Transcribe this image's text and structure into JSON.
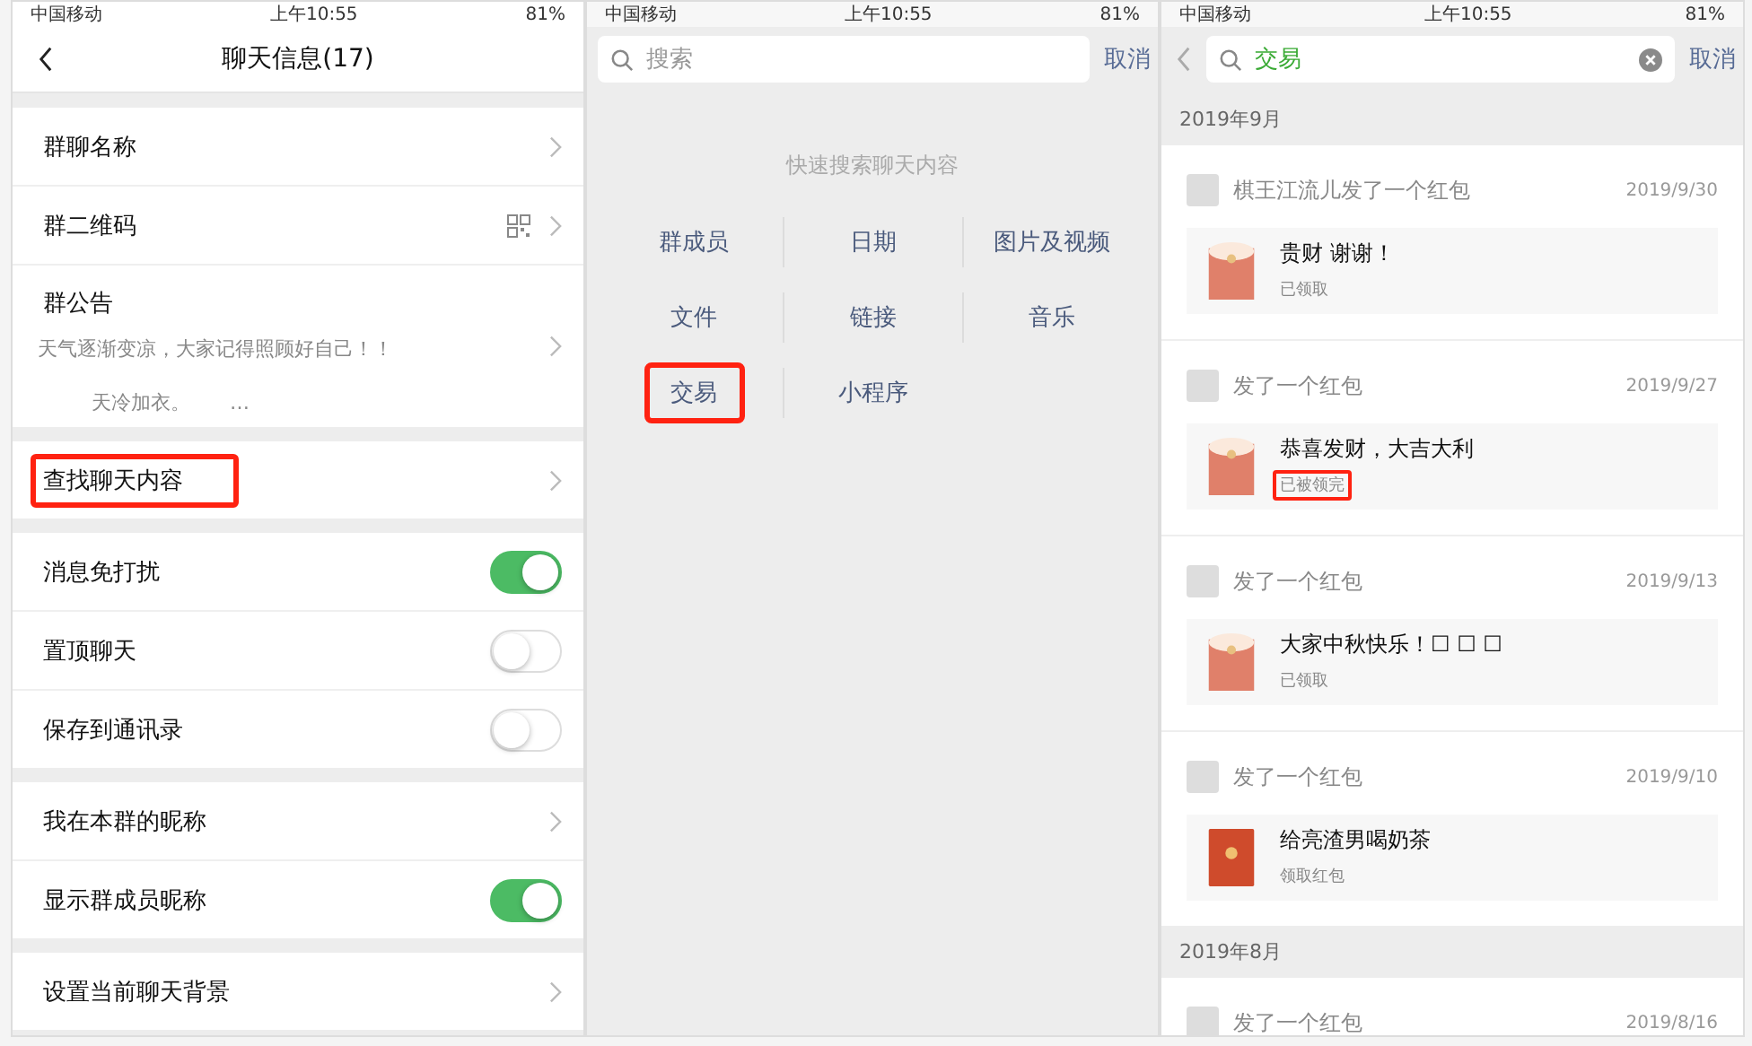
{
  "panels_status": [
    {
      "carrier": "中国移动",
      "time": "上午10:55",
      "battery": "81%"
    },
    {
      "carrier": "中国移动",
      "time": "上午10:55",
      "battery": "81%"
    },
    {
      "carrier": "中国移动",
      "time": "上午10:55",
      "battery": "81%"
    }
  ],
  "chat_info": {
    "title": "聊天信息(17)",
    "groups": [
      {
        "rows": [
          {
            "kind": "link",
            "label": "群聊名称",
            "highlighted": false
          },
          {
            "kind": "qr",
            "label": "群二维码",
            "highlighted": false
          },
          {
            "kind": "notice",
            "label": "群公告",
            "lines": [
              "天气逐渐变凉，大家记得照顾好自己！！",
              "天冷加衣。　　…"
            ],
            "highlighted": false
          }
        ]
      },
      {
        "rows": [
          {
            "kind": "link",
            "label": "查找聊天内容",
            "highlighted": true
          }
        ]
      },
      {
        "rows": [
          {
            "kind": "toggle",
            "label": "消息免打扰",
            "on": true,
            "highlighted": false
          },
          {
            "kind": "toggle",
            "label": "置顶聊天",
            "on": false,
            "highlighted": false
          },
          {
            "kind": "toggle",
            "label": "保存到通讯录",
            "on": false,
            "highlighted": false
          }
        ]
      },
      {
        "rows": [
          {
            "kind": "link",
            "label": "我在本群的昵称",
            "highlighted": false
          },
          {
            "kind": "toggle",
            "label": "显示群成员昵称",
            "on": true,
            "highlighted": false
          }
        ]
      },
      {
        "rows": [
          {
            "kind": "link",
            "label": "设置当前聊天背景",
            "highlighted": false
          }
        ]
      }
    ]
  },
  "quick_search": {
    "placeholder": "搜索",
    "cancel": "取消",
    "hint": "快速搜索聊天内容",
    "rows": [
      [
        {
          "label": "群成员",
          "highlighted": false
        },
        {
          "label": "日期",
          "highlighted": false
        },
        {
          "label": "图片及视频",
          "highlighted": false
        }
      ],
      [
        {
          "label": "文件",
          "highlighted": false
        },
        {
          "label": "链接",
          "highlighted": false
        },
        {
          "label": "音乐",
          "highlighted": false
        }
      ],
      [
        {
          "label": "交易",
          "highlighted": true
        },
        {
          "label": "小程序",
          "highlighted": false
        }
      ]
    ]
  },
  "results": {
    "query": "交易",
    "cancel": "取消",
    "sections": [
      {
        "month": "2019年9月",
        "entries": [
          {
            "sender": "棋王江流儿发了一个红包",
            "date": "2019/9/30",
            "message": "贵财  谢谢！",
            "status": "已领取",
            "opened": true,
            "highlighted": false
          },
          {
            "sender": "发了一个红包",
            "date": "2019/9/27",
            "message": "恭喜发财，大吉大利",
            "status": "已被领完",
            "opened": true,
            "highlighted": true
          },
          {
            "sender": "发了一个红包",
            "date": "2019/9/13",
            "message": "大家中秋快乐！☐ ☐ ☐",
            "status": "已领取",
            "opened": true,
            "highlighted": false
          },
          {
            "sender": "发了一个红包",
            "date": "2019/9/10",
            "message": "给亮渣男喝奶茶",
            "status": "领取红包",
            "opened": false,
            "highlighted": false
          }
        ]
      },
      {
        "month": "2019年8月",
        "entries": [
          {
            "sender": "发了一个红包",
            "date": "2019/8/16"
          }
        ]
      }
    ]
  }
}
